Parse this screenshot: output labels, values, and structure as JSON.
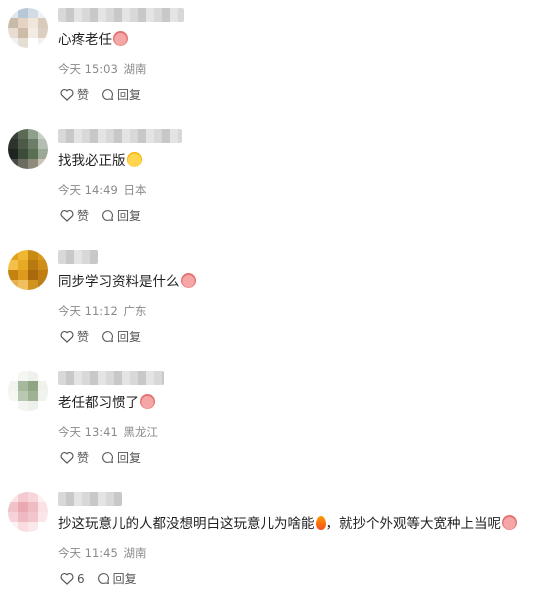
{
  "comments": [
    {
      "text": "心疼老任",
      "emoji": "sad-face-emoji",
      "time": "今天 15:03",
      "location": "湖南",
      "like_label": "赞",
      "reply_label": "回复",
      "avatar_colors": [
        "#dfe6ee",
        "#b8c7d6",
        "#d3dbe4",
        "#eef0f3",
        "#c9b9a8",
        "#e3d3c0",
        "#f0e6da",
        "#d9cbbb",
        "#e8ddd0",
        "#cdbca7",
        "#f3ece4",
        "#dccfc1",
        "#f2f2f2",
        "#e6ddd4",
        "#ffffff",
        "#f5f0ea"
      ]
    },
    {
      "text": "找我必正版",
      "emoji": "wink-face-emoji",
      "time": "今天 14:49",
      "location": "日本",
      "like_label": "赞",
      "reply_label": "回复",
      "avatar_colors": [
        "#3a3f3a",
        "#5b6a55",
        "#8fa08a",
        "#c8cfc6",
        "#2f332e",
        "#4c5a46",
        "#6d7d67",
        "#b4bdb1",
        "#1e2420",
        "#3d4b3a",
        "#597053",
        "#9aa895",
        "#4a4a44",
        "#6b6b5f",
        "#8e8a7c",
        "#c9c4b6"
      ]
    },
    {
      "text": "同步学习资料是什么",
      "emoji": "sad-face-emoji",
      "time": "今天 11:12",
      "location": "广东",
      "like_label": "赞",
      "reply_label": "回复",
      "avatar_colors": [
        "#e0a21c",
        "#f0b531",
        "#c98a12",
        "#d89b20",
        "#f3c04a",
        "#e8aa25",
        "#b77a10",
        "#d08e18",
        "#c4820f",
        "#dd9a1c",
        "#a86a0c",
        "#bf7d12",
        "#e6b04a",
        "#f0c060",
        "#cf9320",
        "#b9801a"
      ]
    },
    {
      "text": "老任都习惯了",
      "emoji": "sad-face-emoji",
      "time": "今天 13:41",
      "location": "黑龙江",
      "like_label": "赞",
      "reply_label": "回复",
      "avatar_colors": [
        "#ffffff",
        "#f4f6f2",
        "#eef1ec",
        "#ffffff",
        "#f2f4ef",
        "#a7b99c",
        "#8fa584",
        "#eef2ea",
        "#f5f7f3",
        "#b9c8b1",
        "#9fb394",
        "#f1f4ee",
        "#ffffff",
        "#f3f5f1",
        "#eef1eb",
        "#ffffff"
      ]
    },
    {
      "text": "抄这玩意儿的人都没想明白这玩意儿为啥能",
      "emoji": "fire-emoji",
      "text2": "，就抄个外观等大宽种上当呢",
      "emoji2": "sad-face-emoji",
      "time": "今天 11:45",
      "location": "湖南",
      "like_label": "6",
      "reply_label": "回复",
      "avatar_colors": [
        "#fbe3e6",
        "#f4c9cf",
        "#f7d6da",
        "#fdf0f1",
        "#f2c2c9",
        "#eaa8b2",
        "#f0bcc4",
        "#fae1e4",
        "#f6d3d8",
        "#efb9c1",
        "#f3c6cd",
        "#fbe7ea",
        "#fdf2f3",
        "#f9dde1",
        "#fbe8eb",
        "#ffffff"
      ]
    }
  ]
}
